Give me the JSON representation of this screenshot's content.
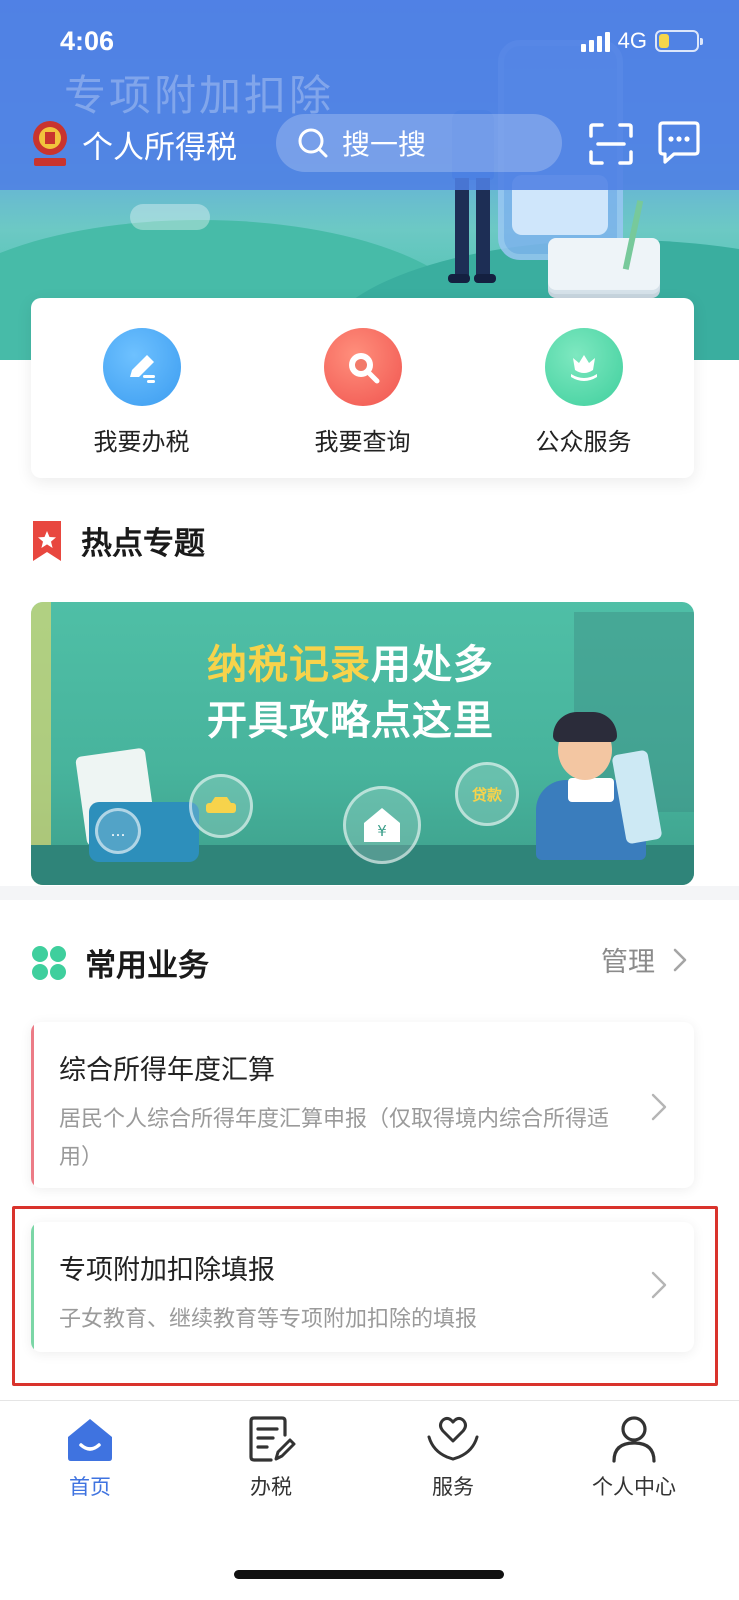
{
  "status_bar": {
    "time": "4:06",
    "network": "4G"
  },
  "header": {
    "background_title": "专项附加扣除",
    "app_title": "个人所得税",
    "search_placeholder": "搜一搜",
    "scan_icon": "scan-icon",
    "message_icon": "message-icon"
  },
  "quick_actions": [
    {
      "label": "我要办税",
      "icon": "pencil-edit-icon",
      "color": "#3b9cf0"
    },
    {
      "label": "我要查询",
      "icon": "magnifier-icon",
      "color": "#f0544f"
    },
    {
      "label": "公众服务",
      "icon": "tulip-icon",
      "color": "#3fcf9d"
    }
  ],
  "hot_topics": {
    "title": "热点专题",
    "banner_line1_highlight": "纳税记录",
    "banner_line1_rest": "用处多",
    "banner_line2": "开具攻略点这里",
    "bubble_labels": [
      "贷款",
      "¥",
      "…"
    ]
  },
  "common_services": {
    "title": "常用业务",
    "manage_label": "管理",
    "items": [
      {
        "title": "综合所得年度汇算",
        "description": "居民个人综合所得年度汇算申报（仅取得境内综合所得适用）",
        "accent": "#ec7b86"
      },
      {
        "title": "专项附加扣除填报",
        "description": "子女教育、继续教育等专项附加扣除的填报",
        "accent": "#7bd6a6",
        "highlighted": true
      }
    ]
  },
  "bottom_nav": [
    {
      "label": "首页",
      "icon": "home-icon",
      "active": true
    },
    {
      "label": "办税",
      "icon": "document-edit-icon",
      "active": false
    },
    {
      "label": "服务",
      "icon": "heart-hands-icon",
      "active": false
    },
    {
      "label": "个人中心",
      "icon": "person-icon",
      "active": false
    }
  ],
  "colors": {
    "brand_blue": "#3f73e0",
    "highlight_red": "#d9332c"
  }
}
